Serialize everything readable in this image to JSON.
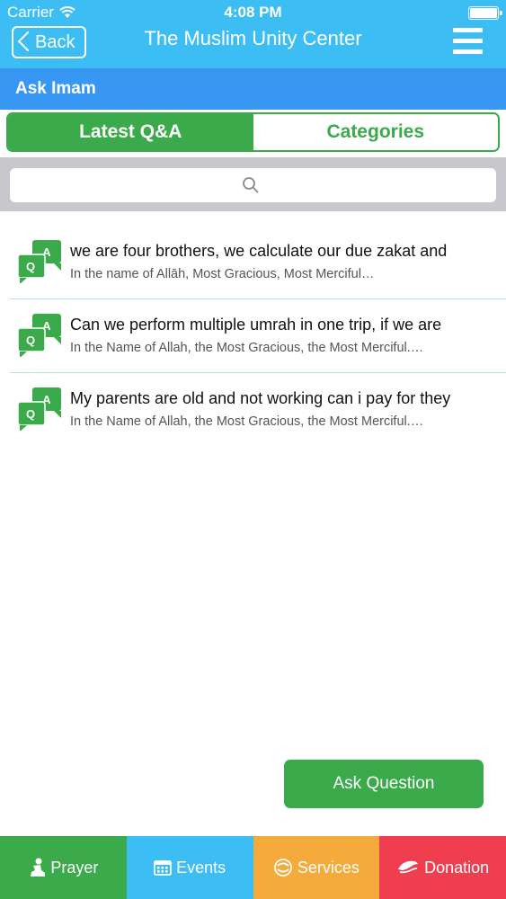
{
  "status_bar": {
    "carrier": "Carrier",
    "time": "4:08 PM"
  },
  "nav": {
    "back_label": "Back",
    "title": "The Muslim Unity Center"
  },
  "section": {
    "title": "Ask Imam"
  },
  "tabs": [
    {
      "label": "Latest Q&A",
      "active": true
    },
    {
      "label": "Categories",
      "active": false
    }
  ],
  "search": {
    "placeholder": ""
  },
  "questions": [
    {
      "question": " we are four brothers, we calculate our due zakat and",
      "snippet": "In the name of Allāh, Most Gracious, Most Merciful…"
    },
    {
      "question": "Can we perform multiple umrah in one trip, if we are",
      "snippet": "In the Name of Allah, the Most Gracious, the Most Merciful.…"
    },
    {
      "question": "My parents are old and not working can i pay for they",
      "snippet": "In the Name of Allah, the Most Gracious, the Most Merciful.…"
    }
  ],
  "ask_button": {
    "label": "Ask Question"
  },
  "tab_bar": [
    {
      "label": "Prayer",
      "icon": "prayer-icon",
      "color": "#3aaa4b"
    },
    {
      "label": "Events",
      "icon": "calendar-icon",
      "color": "#3cbef4"
    },
    {
      "label": "Services",
      "icon": "services-icon",
      "color": "#f5ab3b"
    },
    {
      "label": "Donation",
      "icon": "donation-icon",
      "color": "#ef3e50"
    }
  ],
  "colors": {
    "nav_blue": "#3cbef4",
    "section_blue": "#3897f2",
    "brand_green": "#3aaa4b"
  }
}
